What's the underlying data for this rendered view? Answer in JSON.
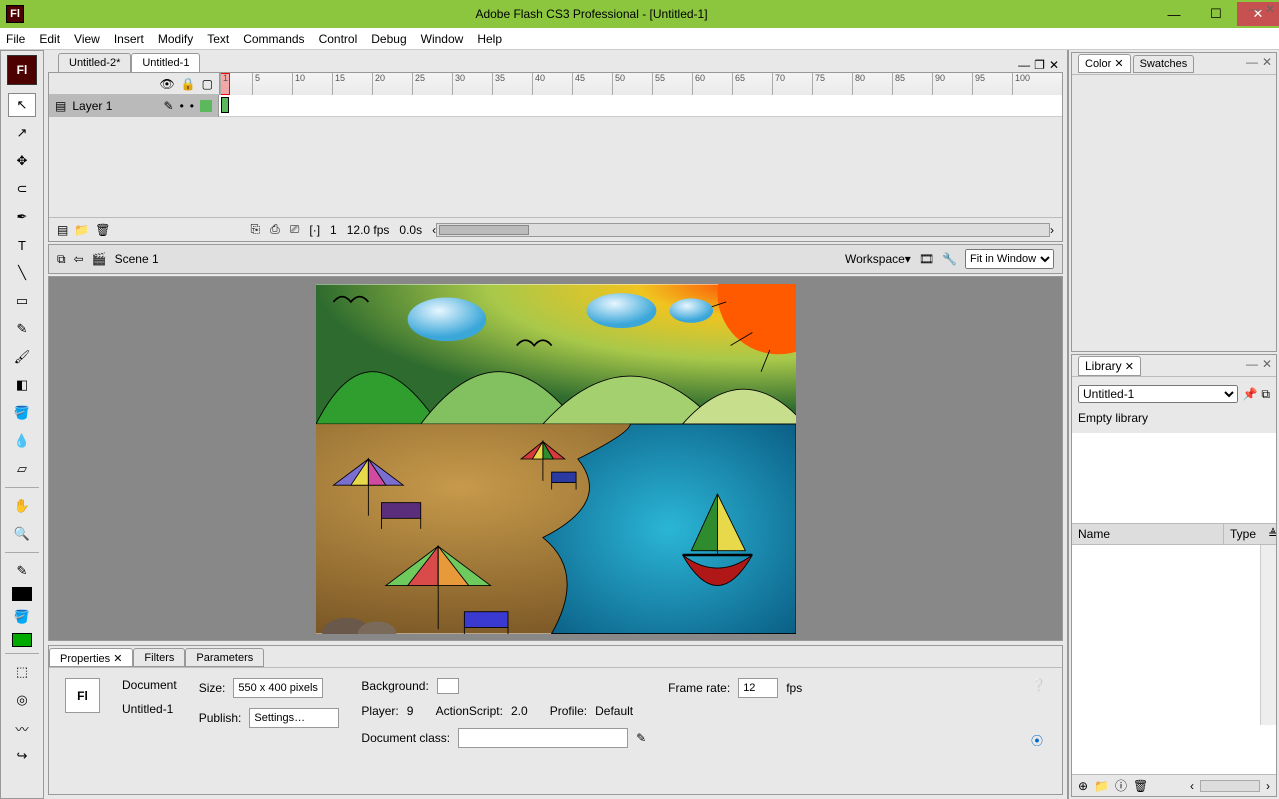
{
  "window": {
    "title": "Adobe Flash CS3 Professional - [Untitled-1]",
    "app_badge": "Fl"
  },
  "menu": [
    "File",
    "Edit",
    "View",
    "Insert",
    "Modify",
    "Text",
    "Commands",
    "Control",
    "Debug",
    "Window",
    "Help"
  ],
  "docTabs": [
    {
      "label": "Untitled-2*",
      "active": false
    },
    {
      "label": "Untitled-1",
      "active": true
    }
  ],
  "timeline": {
    "layer": "Layer 1",
    "ruler_ticks": [
      1,
      5,
      10,
      15,
      20,
      25,
      30,
      35,
      40,
      45,
      50,
      55,
      60,
      65,
      70,
      75,
      80,
      85,
      90,
      95,
      100
    ],
    "footer": {
      "frame": "1",
      "fps": "12.0 fps",
      "time": "0.0s"
    }
  },
  "scenebar": {
    "scene": "Scene 1",
    "workspace_label": "Workspace▾",
    "zoom_options": [
      "Fit in Window"
    ],
    "zoom": "Fit in Window"
  },
  "properties": {
    "tabs": [
      "Properties",
      "Filters",
      "Parameters"
    ],
    "active_tab": 0,
    "doc_label": "Document",
    "doc_name": "Untitled-1",
    "size_label": "Size:",
    "size_value": "550 x 400 pixels",
    "publish_label": "Publish:",
    "publish_value": "Settings…",
    "background_label": "Background:",
    "framerate_label": "Frame rate:",
    "framerate_value": "12",
    "framerate_unit": "fps",
    "player_label": "Player:",
    "player_value": "9",
    "as_label": "ActionScript:",
    "as_value": "2.0",
    "profile_label": "Profile:",
    "profile_value": "Default",
    "docclass_label": "Document class:",
    "docclass_value": ""
  },
  "panels": {
    "top": {
      "tabs": [
        "Color",
        "Swatches"
      ],
      "active": 0
    },
    "library": {
      "title": "Library",
      "doc": "Untitled-1",
      "status": "Empty library",
      "columns": [
        "Name",
        "Type"
      ]
    }
  },
  "tools": {
    "stroke_swatch": "#000000",
    "fill_swatch": "#00aa00"
  }
}
